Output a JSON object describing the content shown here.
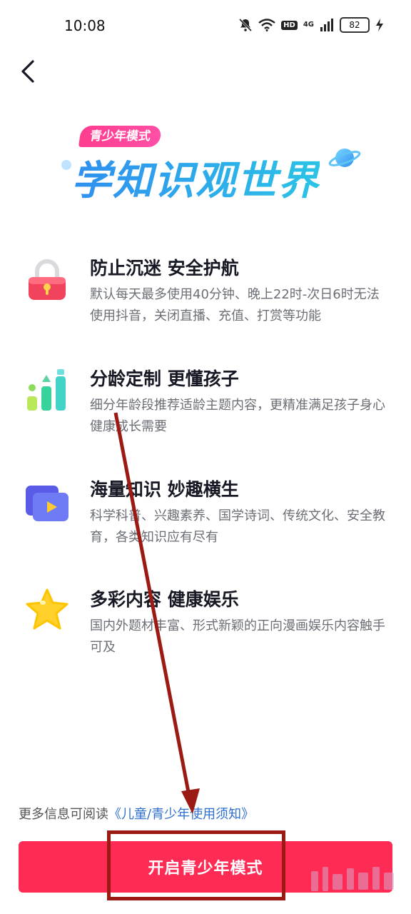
{
  "status_bar": {
    "time": "10:08",
    "network": "4G",
    "hd": "HD",
    "battery": "82"
  },
  "banner": {
    "badge": "青少年模式",
    "title": "学知识观世界"
  },
  "features": [
    {
      "title": "防止沉迷 安全护航",
      "desc": "默认每天最多使用40分钟、晚上22时-次日6时无法使用抖音，关闭直播、充值、打赏等功能",
      "icon": "lock-icon"
    },
    {
      "title": "分龄定制 更懂孩子",
      "desc": "细分年龄段推荐适龄主题内容，更精准满足孩子身心健康成长需要",
      "icon": "bar-chart-icon"
    },
    {
      "title": "海量知识 妙趣横生",
      "desc": "科学科普、兴趣素养、国学诗词、传统文化、安全教育，各类知识应有尽有",
      "icon": "video-folder-icon"
    },
    {
      "title": "多彩内容 健康娱乐",
      "desc": "国内外题材丰富、形式新颖的正向漫画娱乐内容触手可及",
      "icon": "star-icon"
    }
  ],
  "footer": {
    "more_info_prefix": "更多信息可阅读",
    "more_info_link": "《儿童/青少年使用须知》",
    "primary_button": "开启青少年模式"
  },
  "colors": {
    "primary": "#fe2c55",
    "link": "#2f6fd0",
    "annotation": "#9b1b14"
  }
}
